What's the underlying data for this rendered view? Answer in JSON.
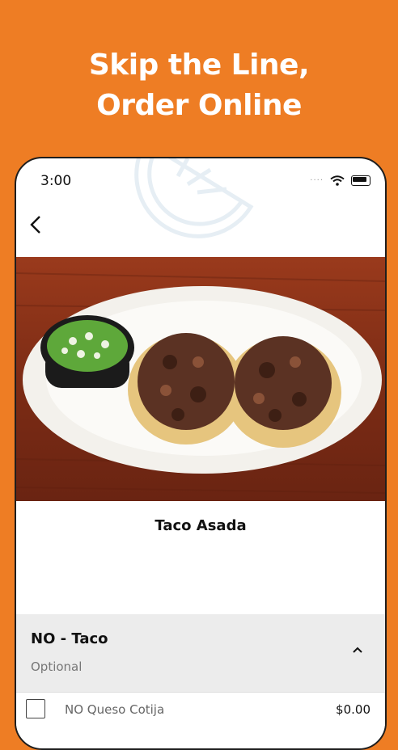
{
  "promo": {
    "headline_line1": "Skip the Line,",
    "headline_line2": "Order Online"
  },
  "status_bar": {
    "time": "3:00",
    "signal_dots": "····"
  },
  "item": {
    "name": "Taco Asada",
    "image": "tacos-asada-photo"
  },
  "modifier_group": {
    "title": "NO - Taco",
    "subtitle": "Optional",
    "expanded": true,
    "options": [
      {
        "label": "NO Queso Cotija",
        "price": "$0.00",
        "checked": false
      }
    ]
  },
  "colors": {
    "brand": "#EE7D24",
    "section_bg": "#ECECEC"
  },
  "icons": [
    "orange-slice-watermark-icon",
    "wifi-icon",
    "battery-icon",
    "back-arrow-icon",
    "chevron-up-icon",
    "checkbox-icon"
  ]
}
